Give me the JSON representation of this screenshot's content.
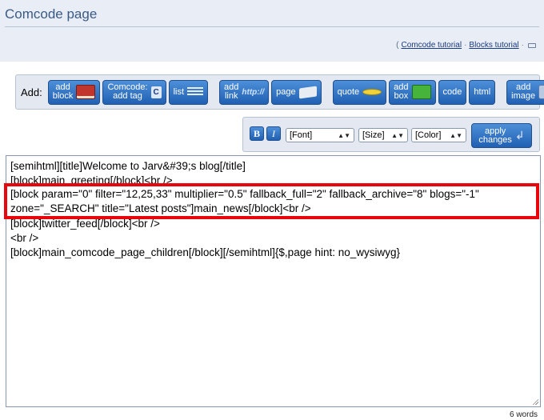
{
  "page": {
    "title": "Comcode page"
  },
  "help": {
    "open_paren": "(",
    "comcode_tutorial": "Comcode tutorial",
    "dot1": "·",
    "blocks_tutorial": "Blocks tutorial",
    "dot2": "·"
  },
  "toolbar": {
    "add_label": "Add:",
    "buttons": [
      {
        "label": "add\nblock",
        "icon": "book-icon"
      },
      {
        "label": "Comcode:\nadd tag",
        "icon": "comcode-icon"
      },
      {
        "label": "list",
        "icon": "list-icon"
      },
      {
        "label": "add\nlink",
        "icon": "http-icon",
        "icon_text": "http://"
      },
      {
        "label": "page",
        "icon": "pages-icon"
      },
      {
        "label": "quote",
        "icon": "quote-icon"
      },
      {
        "label": "add\nbox",
        "icon": "box-icon"
      },
      {
        "label": "code",
        "icon": "code-icon"
      },
      {
        "label": "html",
        "icon": "html-icon"
      },
      {
        "label": "add\nimage",
        "icon": "image-icon"
      }
    ]
  },
  "format_bar": {
    "bold": "B",
    "italic": "I",
    "font": "[Font]",
    "size": "[Size]",
    "color": "[Color]",
    "apply": "apply\nchanges"
  },
  "editor": {
    "lines": [
      "[semihtml][title]Welcome to Jarv&#39;s blog[/title]",
      "[block]main_greeting[/block]<br />",
      "[block param=\"0\" filter=\"12,25,33\" multiplier=\"0.5\" fallback_full=\"2\" fallback_archive=\"8\" blogs=\"-1\"",
      "zone=\"_SEARCH\" title=\"Latest posts\"]main_news[/block]<br />",
      "[block]twitter_feed[/block]<br />",
      "<br />",
      "[block]main_comcode_page_children[/block][/semihtml]{$,page hint: no_wysiwyg}"
    ],
    "highlight_color": "#e8060c"
  },
  "status": {
    "word_count": "6 words"
  }
}
